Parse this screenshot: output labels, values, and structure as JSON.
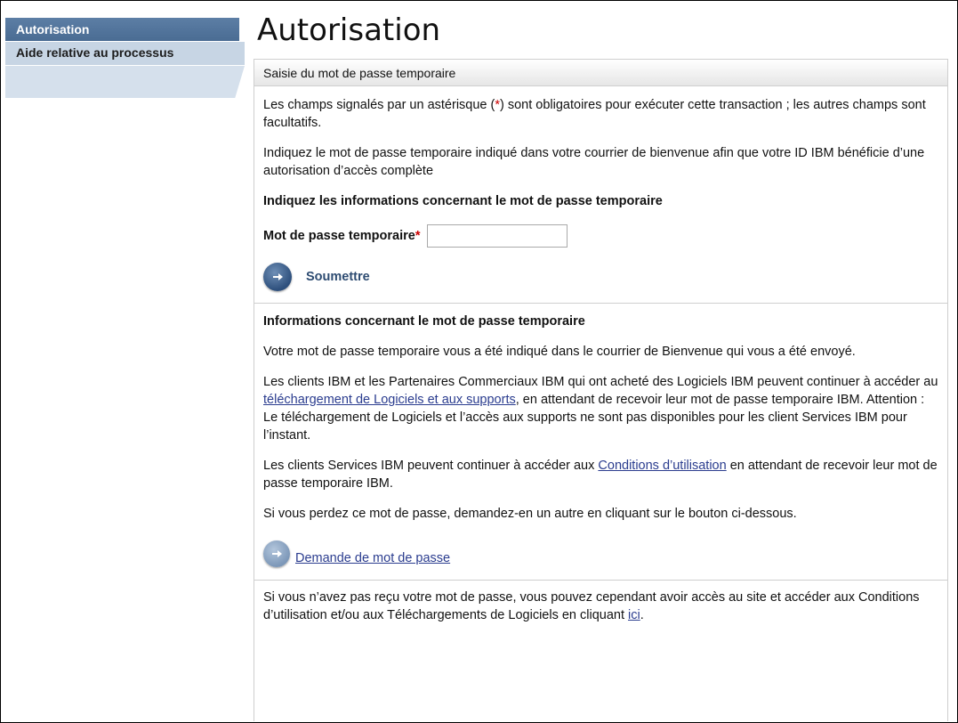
{
  "sidebar": {
    "items": [
      {
        "label": "Autorisation",
        "active": true
      },
      {
        "label": "Aide relative au processus",
        "active": false
      }
    ]
  },
  "page": {
    "title": "Autorisation"
  },
  "panel": {
    "header": "Saisie du mot de passe temporaire",
    "intro": {
      "pre": "Les champs signalés par un astérisque (",
      "mark": "*",
      "post": ") sont obligatoires pour exécuter cette transaction ; les autres champs sont facultatifs."
    },
    "instruction": "Indiquez le mot de passe temporaire indiqué dans votre courrier de bienvenue afin que votre ID IBM bénéficie d’une autorisation d’accès complète",
    "form_heading": "Indiquez les informations concernant le mot de passe temporaire",
    "field": {
      "label": "Mot de passe temporaire",
      "required_mark": "*",
      "value": ""
    },
    "submit_label": "Soumettre"
  },
  "info": {
    "heading": "Informations concernant le mot de passe temporaire",
    "p1": "Votre mot de passe temporaire vous a été indiqué dans le courrier de Bienvenue qui vous a été envoyé.",
    "p2": {
      "pre": "Les clients IBM et les Partenaires Commerciaux IBM qui ont acheté des Logiciels IBM peuvent continuer à accéder au ",
      "link": "téléchargement de Logiciels et aux supports",
      "post": ", en attendant de recevoir leur mot de passe temporaire IBM. Attention : Le téléchargement de Logiciels et l’accès aux supports ne sont pas disponibles pour les client Services IBM pour l’instant."
    },
    "p3": {
      "pre": "Les clients Services IBM peuvent continuer à accéder aux ",
      "link": "Conditions d’utilisation",
      "post": " en attendant de recevoir leur mot de passe temporaire IBM."
    },
    "p4": "Si vous perdez ce mot de passe, demandez-en un autre en cliquant sur le bouton ci-dessous.",
    "request_label": "Demande de mot de passe"
  },
  "footer_note": {
    "pre": "Si vous n’avez pas reçu votre mot de passe, vous pouvez cependant avoir accès au site et accéder aux Conditions d’utilisation et/ou aux Téléchargements de Logiciels en cliquant ",
    "link": "ici",
    "post": "."
  },
  "icons": {
    "submit": "arrow-right-icon",
    "request": "arrow-right-icon"
  },
  "colors": {
    "sidebar_active": "#4f72a0",
    "sidebar_item": "#c7d5e4",
    "link": "#2b3d8f",
    "required": "#cc0000"
  }
}
